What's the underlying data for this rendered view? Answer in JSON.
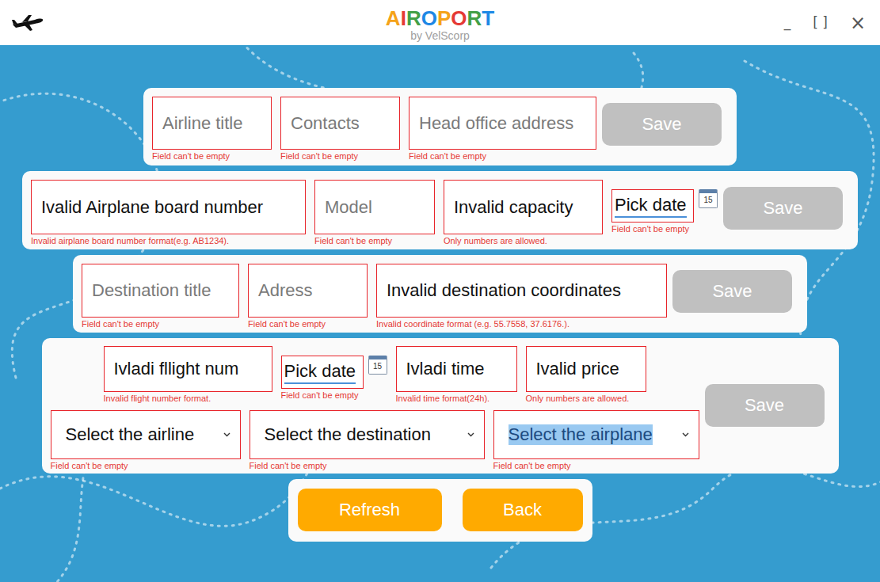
{
  "window": {
    "logo_letters": [
      {
        "char": "A",
        "color": "#f5a31a"
      },
      {
        "char": "I",
        "color": "#e53935"
      },
      {
        "char": "R",
        "color": "#43a047"
      },
      {
        "char": "O",
        "color": "#1e88e5"
      },
      {
        "char": "P",
        "color": "#f5a31a"
      },
      {
        "char": "O",
        "color": "#e53935"
      },
      {
        "char": "R",
        "color": "#43a047"
      },
      {
        "char": "T",
        "color": "#1e88e5"
      }
    ],
    "subtitle": "by VelScorp",
    "controls": [
      "_",
      "[ ]",
      "×"
    ]
  },
  "forms": [
    {
      "rows": [
        [
          {
            "kind": "input",
            "text": "Airline title",
            "filled": false,
            "invalid": true,
            "error": "Field can't be empty"
          },
          {
            "kind": "input",
            "text": "Contacts",
            "filled": false,
            "invalid": true,
            "error": "Field can't be empty"
          },
          {
            "kind": "input",
            "text": "Head office address",
            "filled": false,
            "invalid": true,
            "error": "Field can't be empty"
          }
        ]
      ],
      "save": "Save",
      "disabled": true
    },
    {
      "rows": [
        [
          {
            "kind": "input",
            "text": "Ivalid Airplane board number",
            "filled": true,
            "invalid": true,
            "error": "Invalid airplane board number format(e.g. AB1234)."
          },
          {
            "kind": "input",
            "text": "Model",
            "filled": false,
            "invalid": true,
            "error": "Field can't be empty"
          },
          {
            "kind": "input",
            "text": "Invalid capacity",
            "filled": true,
            "invalid": true,
            "error": "Only numbers are allowed."
          },
          {
            "kind": "date",
            "text": "Pick date",
            "calendar_day": "15",
            "invalid": true,
            "error": "Field can't be empty"
          }
        ]
      ],
      "save": "Save",
      "disabled": true
    },
    {
      "rows": [
        [
          {
            "kind": "input",
            "text": "Destination title",
            "filled": false,
            "invalid": true,
            "error": "Field can't be empty"
          },
          {
            "kind": "input",
            "text": "Adress",
            "filled": false,
            "invalid": true,
            "error": "Field can't be empty"
          },
          {
            "kind": "input",
            "text": "Invalid destination coordinates",
            "filled": true,
            "invalid": true,
            "error": "Invalid coordinate format (e.g. 55.7558, 37.6176.)."
          }
        ]
      ],
      "save": "Save",
      "disabled": true
    },
    {
      "rows": [
        [
          {
            "kind": "input",
            "text": "Ivladi fllight num",
            "filled": true,
            "invalid": true,
            "error": "Invalid flight number format."
          },
          {
            "kind": "date",
            "text": "Pick date",
            "calendar_day": "15",
            "invalid": true,
            "error": "Field can't be empty"
          },
          {
            "kind": "input",
            "text": "Ivladi time",
            "filled": true,
            "invalid": true,
            "error": "Invalid time format(24h)."
          },
          {
            "kind": "input",
            "text": "Ivalid price",
            "filled": true,
            "invalid": true,
            "error": "Only numbers are allowed."
          }
        ],
        [
          {
            "kind": "select",
            "text": "Select the airline",
            "highlighted": false,
            "invalid": true,
            "error": "Field can't be empty"
          },
          {
            "kind": "select",
            "text": "Select the destination",
            "highlighted": false,
            "invalid": true,
            "error": "Field can't be empty"
          },
          {
            "kind": "select",
            "text": "Select the airplane",
            "highlighted": true,
            "invalid": true,
            "error": "Field can't be empty"
          }
        ]
      ],
      "save": "Save",
      "disabled": true
    }
  ],
  "nav_buttons": [
    "Refresh",
    "Back"
  ]
}
